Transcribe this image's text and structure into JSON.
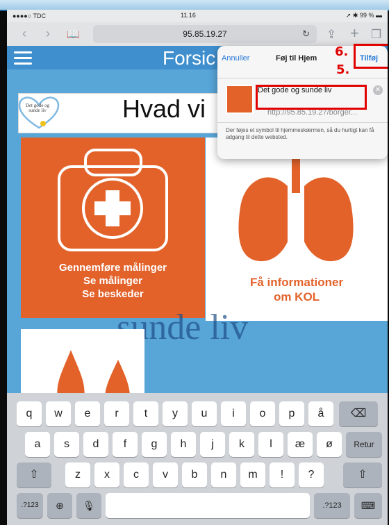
{
  "status": {
    "carrier": "●●●●○ TDC",
    "time": "11.16",
    "battery": "99 %"
  },
  "browser": {
    "url": "95.85.19.27",
    "reload_icon": "reload-icon"
  },
  "site": {
    "brand": "Forsic",
    "heading": "Hvad vi",
    "logo_text": "Det gode og sunde liv"
  },
  "tiles": {
    "measure": {
      "lines": [
        "Gennemføre målinger",
        "Se målinger",
        "Se beskeder"
      ]
    },
    "kol": {
      "lines": [
        "Få informationer",
        "om KOL"
      ]
    },
    "background_text": "sunde liv"
  },
  "popover": {
    "cancel": "Annuller",
    "title": "Føj til Hjem",
    "add": "Tilføj",
    "name_value": "Det gode og sunde liv",
    "url": "http://95.85.19.27/borger...",
    "description": "Der føjes et symbol til hjemmeskærmen, så du hurtigt kan få adgang til dette websted."
  },
  "annotations": {
    "step5": "5.",
    "step6": "6."
  },
  "keyboard": {
    "row1": [
      "q",
      "w",
      "e",
      "r",
      "t",
      "y",
      "u",
      "i",
      "o",
      "p",
      "å"
    ],
    "row2": [
      "a",
      "s",
      "d",
      "f",
      "g",
      "h",
      "j",
      "k",
      "l",
      "æ",
      "ø"
    ],
    "row3": [
      "z",
      "x",
      "c",
      "v",
      "b",
      "n",
      "m",
      "!",
      "?"
    ],
    "return": "Retur",
    "numbers": ".?123",
    "backspace_icon": "backspace-icon",
    "shift_icon": "shift-icon",
    "globe_icon": "globe-icon",
    "mic_icon": "microphone-icon",
    "keyboard_icon": "keyboard-hide-icon"
  },
  "colors": {
    "accent_orange": "#e2622a",
    "site_blue": "#3f8fce",
    "annotation_red": "#e10000",
    "link_blue": "#2a7bd7"
  }
}
